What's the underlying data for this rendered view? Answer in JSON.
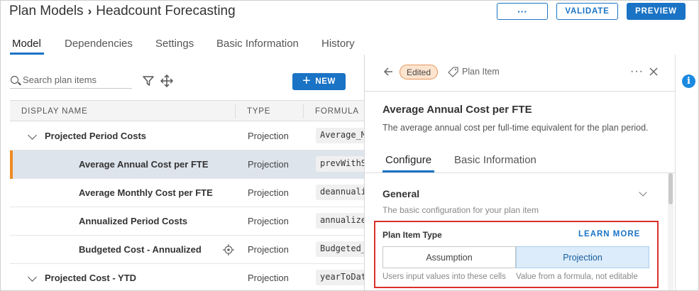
{
  "header": {
    "breadcrumb_root": "Plan Models",
    "breadcrumb_sep": "›",
    "title": "Headcount Forecasting",
    "more_label": "···",
    "validate_label": "VALIDATE",
    "preview_label": "PREVIEW"
  },
  "tabs": [
    {
      "label": "Model",
      "active": true
    },
    {
      "label": "Dependencies"
    },
    {
      "label": "Settings"
    },
    {
      "label": "Basic Information"
    },
    {
      "label": "History"
    }
  ],
  "toolbar": {
    "search_placeholder": "Search plan items",
    "new_label": "NEW"
  },
  "table": {
    "columns": [
      "DISPLAY NAME",
      "TYPE",
      "FORMULA"
    ],
    "rows": [
      {
        "name": "Projected Period Costs",
        "type": "Projection",
        "formula": "Average_M",
        "group": true
      },
      {
        "name": "Average Annual Cost per FTE",
        "type": "Projection",
        "formula": "prevWithS",
        "selected": true
      },
      {
        "name": "Average Monthly Cost per FTE",
        "type": "Projection",
        "formula": "deannualiz"
      },
      {
        "name": "Annualized Period Costs",
        "type": "Projection",
        "formula": "annualize("
      },
      {
        "name": "Budgeted Cost - Annualized",
        "type": "Projection",
        "formula": "Budgeted_",
        "target_icon": true
      },
      {
        "name": "Projected Cost - YTD",
        "type": "Projection",
        "formula": "yearToDat",
        "group": true
      }
    ]
  },
  "detail": {
    "badge": "Edited",
    "kind": "Plan Item",
    "more_label": "···",
    "title": "Average Annual Cost per FTE",
    "description": "The average annual cost per full-time equivalent for the plan period.",
    "tabs": [
      {
        "label": "Configure",
        "active": true
      },
      {
        "label": "Basic Information"
      }
    ],
    "general": {
      "title": "General",
      "description": "The basic configuration for your plan item"
    },
    "plan_item_type": {
      "label": "Plan Item Type",
      "learn_more": "LEARN MORE",
      "options": [
        {
          "label": "Assumption",
          "hint": "Users input values into these cells"
        },
        {
          "label": "Projection",
          "hint": "Value from a formula, not editable",
          "selected": true
        }
      ]
    }
  },
  "colors": {
    "accent": "#1a73c5",
    "selected_row": "#dde4ec",
    "row_marker": "#f08a24",
    "badge_bg": "#fde4cf",
    "highlight_border": "#d9302c"
  }
}
